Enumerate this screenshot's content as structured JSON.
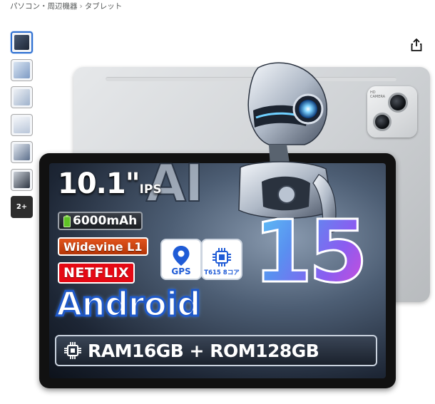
{
  "breadcrumb": {
    "items": [
      "パソコン・周辺機器",
      "タブレット"
    ],
    "separator": "›"
  },
  "gallery": {
    "thumbnails": [
      {
        "name": "thumb-1",
        "active": true
      },
      {
        "name": "thumb-2",
        "active": false
      },
      {
        "name": "thumb-3",
        "active": false
      },
      {
        "name": "thumb-4",
        "active": false
      },
      {
        "name": "thumb-5",
        "active": false
      },
      {
        "name": "thumb-6",
        "active": false
      }
    ],
    "more_label": "2+",
    "share_icon": "share-icon"
  },
  "product_image": {
    "screen_size_number": "10.1\"",
    "screen_type": "IPS",
    "battery": "6000mAh",
    "drm": "Widevine L1",
    "streaming": "NETFLIX",
    "gps_label": "GPS",
    "cpu_label": "T615 8コア",
    "ai_label": "AI",
    "os_name": "Android",
    "os_version": "15",
    "memory": "RAM16GB + ROM128GB",
    "camera_label": "HD CAMERA"
  },
  "colors": {
    "accent_blue": "#2d6fd1",
    "netflix_red": "#e50914",
    "widevine_orange": "#e2541c",
    "gps_blue": "#1f5bd6"
  }
}
